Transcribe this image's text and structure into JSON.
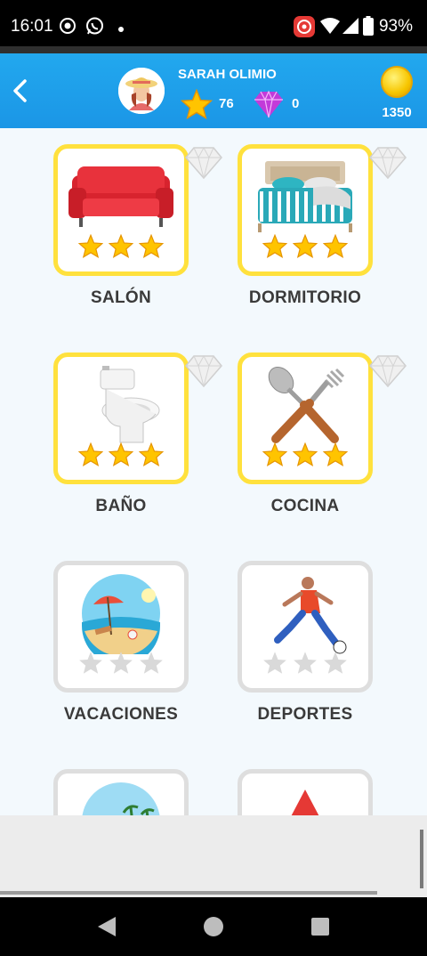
{
  "status_bar": {
    "time": "16:01",
    "battery": "93%"
  },
  "header": {
    "player_name": "SARAH OLIMIO",
    "stars": "76",
    "gems": "0",
    "coins": "1350"
  },
  "categories": [
    {
      "label": "SALÓN",
      "locked": false
    },
    {
      "label": "DORMITORIO",
      "locked": false
    },
    {
      "label": "BAÑO",
      "locked": false
    },
    {
      "label": "COCINA",
      "locked": false
    },
    {
      "label": "VACACIONES",
      "locked": true
    },
    {
      "label": "DEPORTES",
      "locked": true
    }
  ],
  "colors": {
    "header_blue": "#1b96e6",
    "unlocked_border": "#ffe13d",
    "locked_border": "#dedede",
    "star_gold": "#f7b500"
  }
}
